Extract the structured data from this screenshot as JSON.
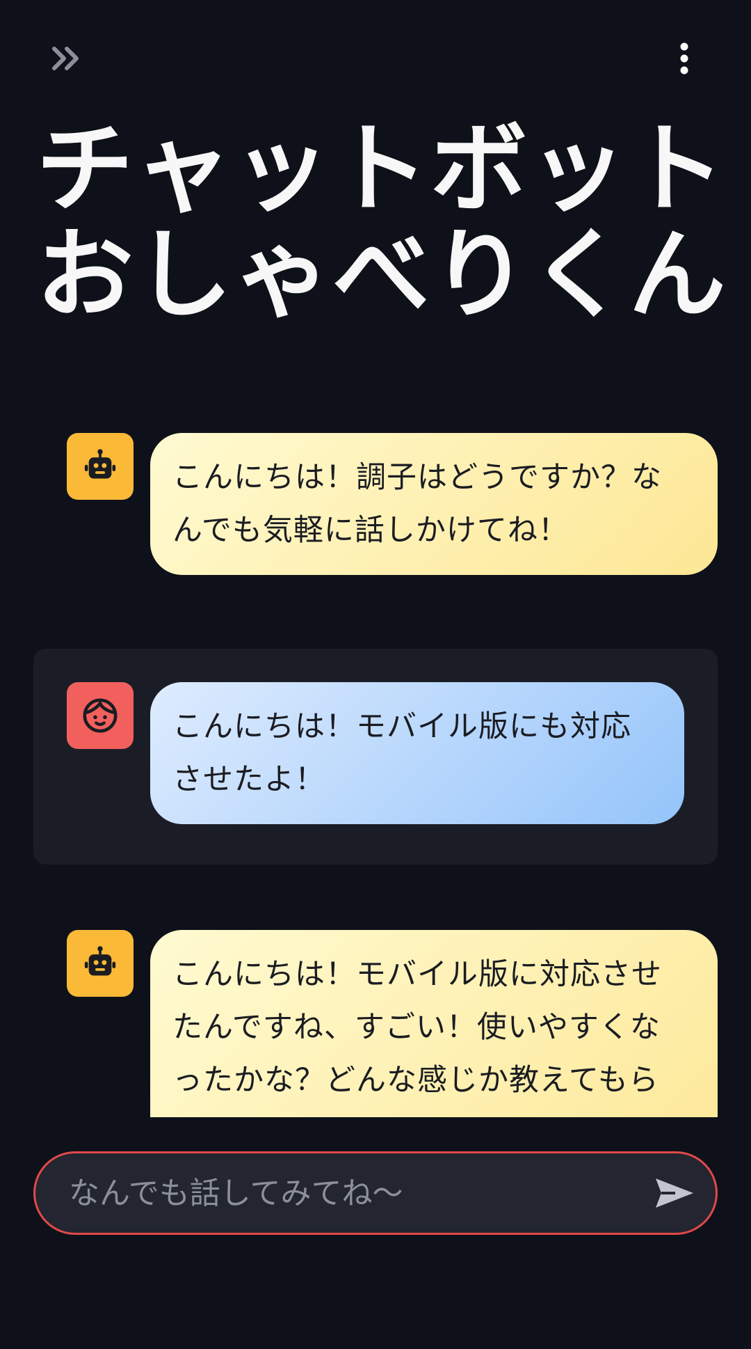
{
  "header": {
    "expand_icon": "double-chevron-right-icon",
    "menu_icon": "vertical-dots-icon"
  },
  "title": {
    "line1": "チャットボット",
    "line2": "おしゃべりくん"
  },
  "messages": [
    {
      "role": "bot",
      "avatar_icon": "robot-icon",
      "lines": [
        "こんにちは！調子はどうですか？な",
        "んでも気軽に話しかけてね！"
      ]
    },
    {
      "role": "user",
      "avatar_icon": "face-icon",
      "lines": [
        "こんにちは！モバイル版にも対応",
        "させたよ！"
      ]
    },
    {
      "role": "bot",
      "avatar_icon": "robot-icon",
      "lines": [
        "こんにちは！モバイル版に対応させ",
        "たんですね、すごい！使いやすくな",
        "ったかな？どんな感じか教えてもら"
      ]
    }
  ],
  "input": {
    "placeholder": "なんでも話してみてね〜",
    "value": ""
  },
  "send_icon": "send-icon",
  "colors": {
    "background": "#0e1119",
    "bot_avatar": "#fbb938",
    "user_avatar": "#f2605d",
    "input_border": "#e1494a"
  }
}
